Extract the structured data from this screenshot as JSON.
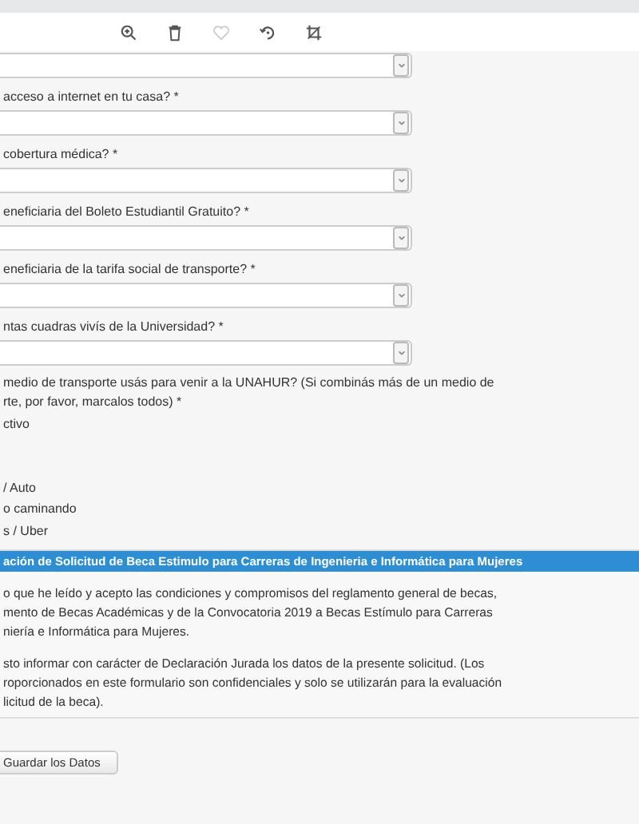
{
  "toolbar": {
    "icons": [
      {
        "kind": "zoom"
      },
      {
        "kind": "trash"
      },
      {
        "kind": "heart",
        "disabled": true
      },
      {
        "kind": "rotate"
      },
      {
        "kind": "crop"
      }
    ]
  },
  "form": {
    "questions": [
      {
        "label": "acceso a internet en tu casa? *"
      },
      {
        "label": "cobertura médica? *"
      },
      {
        "label": "eneficiaria del Boleto Estudiantil Gratuito? *"
      },
      {
        "label": "eneficiaria de la tarifa social de transporte? *"
      },
      {
        "label": "ntas cuadras vivís de la Universidad? *"
      }
    ],
    "transport": {
      "question_lines": [
        "medio de transporte usás para venir a la UNAHUR? (Si combinás más de un medio de",
        "rte, por favor, marcalos todos) *"
      ],
      "options_top": [
        "ctivo"
      ],
      "options_bottom": [
        "/ Auto",
        "o caminando",
        "s / Uber"
      ]
    }
  },
  "panel": {
    "title": "ación de Solicitud de Beca Estimulo para Carreras de Ingenieria e Informática para Mujeres",
    "paragraphs": [
      [
        "o que he leído y acepto las condiciones y compromisos del reglamento general de becas,",
        "mento de Becas Académicas y de la Convocatoria 2019 a Becas Estímulo para Carreras",
        "niería e Informática para Mujeres."
      ],
      [
        "sto informar con carácter de Declaración Jurada los datos de la presente solicitud. (Los",
        "roporcionados en este formulario son confidenciales y solo se utilizarán para la evaluación",
        "licitud de la beca)."
      ]
    ]
  },
  "save_button": "Guardar los Datos"
}
